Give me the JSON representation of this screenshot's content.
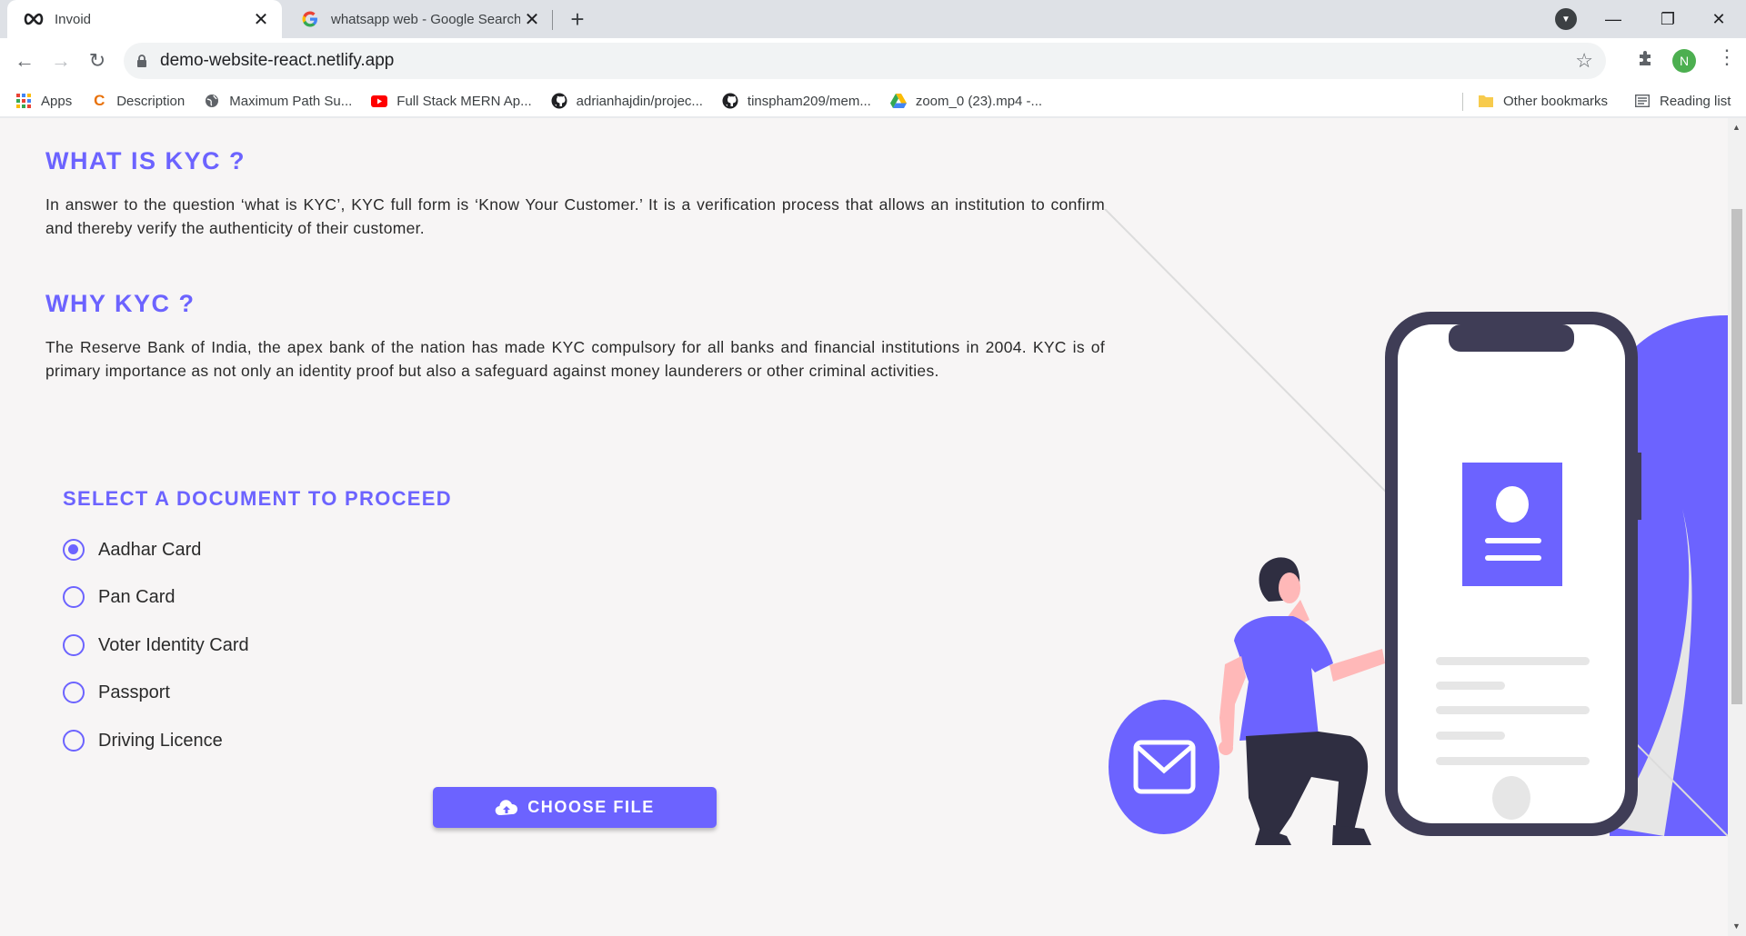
{
  "browser": {
    "tabs": [
      {
        "title": "Invoid",
        "icon": "infinity-icon"
      },
      {
        "title": "whatsapp web - Google Search",
        "icon": "google-icon"
      }
    ],
    "url": "demo-website-react.netlify.app",
    "avatar_letter": "N",
    "bookmarks": [
      {
        "label": "Apps",
        "icon": "apps-grid-icon"
      },
      {
        "label": "Description",
        "icon": "c-logo-icon"
      },
      {
        "label": "Maximum Path Su...",
        "icon": "globe-icon"
      },
      {
        "label": "Full Stack MERN Ap...",
        "icon": "youtube-icon"
      },
      {
        "label": "adrianhajdin/projec...",
        "icon": "github-icon"
      },
      {
        "label": "tinspham209/mem...",
        "icon": "github-icon"
      },
      {
        "label": "zoom_0 (23).mp4 -...",
        "icon": "google-drive-icon"
      }
    ],
    "other_bookmarks": "Other bookmarks",
    "reading_list": "Reading list"
  },
  "page": {
    "what_title": "WHAT IS KYC ?",
    "what_text": "In answer to the question ‘what is KYC’, KYC full form is ‘Know Your Customer.’ It is a verification process that allows an institution to confirm and thereby verify the authenticity of their customer.",
    "why_title": "WHY KYC ?",
    "why_text": "The Reserve Bank of India, the apex bank of the nation has made KYC compulsory for all banks and financial institutions in 2004. KYC is of primary importance as not only an identity proof but also a safeguard against money launderers or other criminal activities.",
    "select_title": "SELECT A DOCUMENT TO PROCEED",
    "options": [
      {
        "label": "Aadhar Card",
        "checked": true
      },
      {
        "label": "Pan Card",
        "checked": false
      },
      {
        "label": "Voter Identity Card",
        "checked": false
      },
      {
        "label": "Passport",
        "checked": false
      },
      {
        "label": "Driving Licence",
        "checked": false
      }
    ],
    "choose_file_label": "CHOOSE FILE",
    "accent_color": "#6c63ff"
  }
}
